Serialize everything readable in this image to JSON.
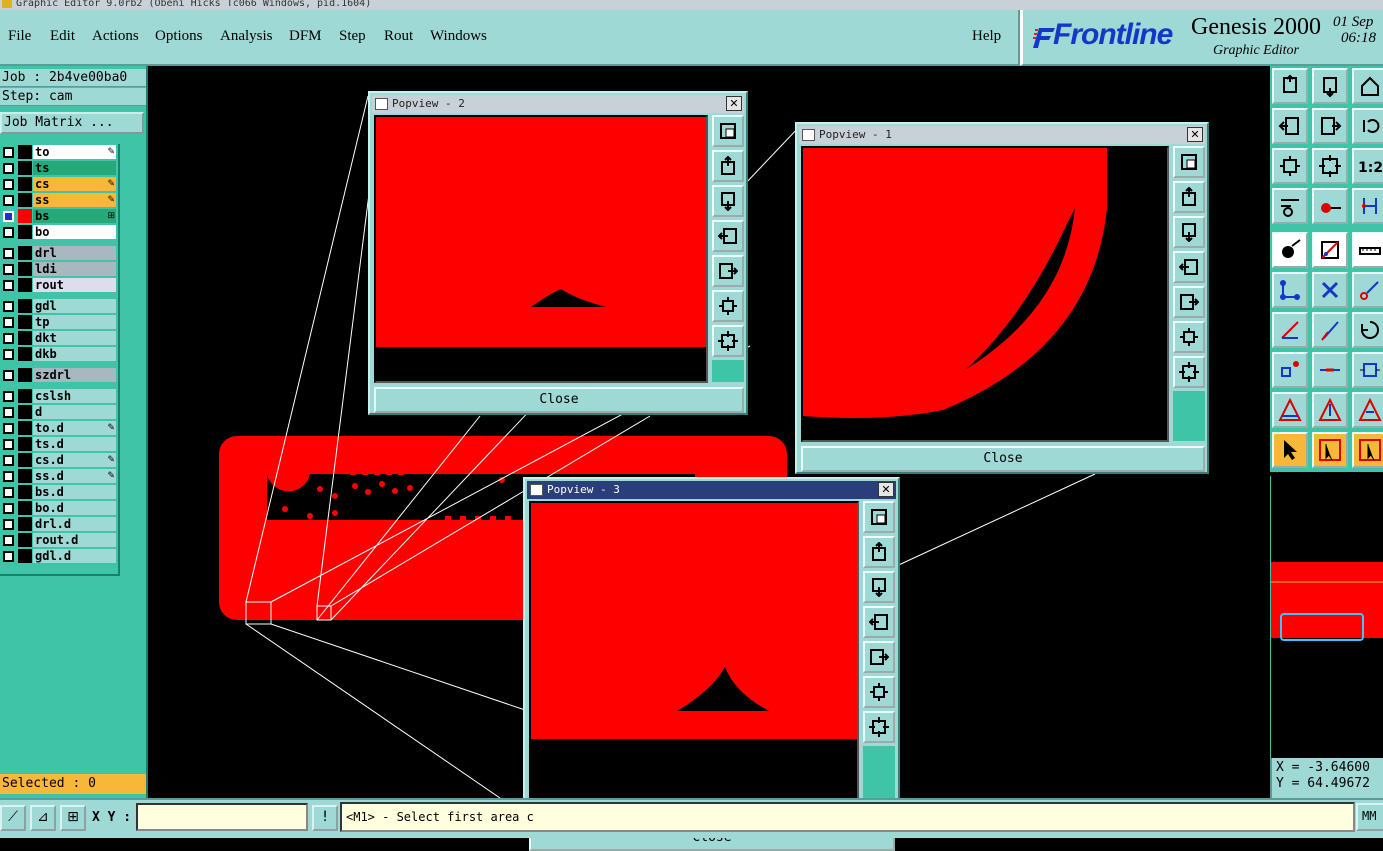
{
  "title_bar": "Graphic Editor 9.0rb2 (Obeni Hicks Tc066 Windows, pid.1604)",
  "menu": [
    {
      "label": "File"
    },
    {
      "label": "Edit"
    },
    {
      "label": "Actions"
    },
    {
      "label": "Options"
    },
    {
      "label": "Analysis"
    },
    {
      "label": "DFM"
    },
    {
      "label": "Step"
    },
    {
      "label": "Rout"
    },
    {
      "label": "Windows"
    },
    {
      "label": "Help"
    }
  ],
  "brand": {
    "logo": "Frontline",
    "product": "Genesis 2000",
    "subtitle": "Graphic Editor",
    "date": "01 Sep",
    "time": "06:18"
  },
  "job": {
    "label": "Job : 2b4ve00ba0",
    "step": "Step: cam",
    "matrix_button": "Job Matrix ..."
  },
  "layers": [
    {
      "name": "to",
      "style": "white",
      "marker": "✎",
      "active": false,
      "red": false
    },
    {
      "name": "ts",
      "style": "green",
      "marker": "",
      "active": false,
      "red": false
    },
    {
      "name": "cs",
      "style": "orange",
      "marker": "✎",
      "active": false,
      "red": false
    },
    {
      "name": "ss",
      "style": "orange",
      "marker": "✎",
      "active": false,
      "red": false
    },
    {
      "name": "bs",
      "style": "green",
      "marker": "⊞",
      "active": true,
      "red": true
    },
    {
      "name": "bo",
      "style": "white",
      "marker": "",
      "active": false,
      "red": false
    },
    {
      "name": "drl",
      "style": "grey",
      "marker": "",
      "active": false,
      "red": false
    },
    {
      "name": "ldi",
      "style": "grey",
      "marker": "",
      "active": false,
      "red": false
    },
    {
      "name": "rout",
      "style": "lgrey",
      "marker": "",
      "active": false,
      "red": false
    },
    {
      "name": "gdl",
      "style": "teal",
      "marker": "",
      "active": false,
      "red": false
    },
    {
      "name": "tp",
      "style": "teal",
      "marker": "",
      "active": false,
      "red": false
    },
    {
      "name": "dkt",
      "style": "teal",
      "marker": "",
      "active": false,
      "red": false
    },
    {
      "name": "dkb",
      "style": "teal",
      "marker": "",
      "active": false,
      "red": false
    },
    {
      "name": "szdrl",
      "style": "grey",
      "marker": "",
      "active": false,
      "red": false
    },
    {
      "name": "cslsh",
      "style": "teal",
      "marker": "",
      "active": false,
      "red": false
    },
    {
      "name": "d",
      "style": "teal",
      "marker": "",
      "active": false,
      "red": false
    },
    {
      "name": "to.d",
      "style": "teal",
      "marker": "✎",
      "active": false,
      "red": false
    },
    {
      "name": "ts.d",
      "style": "teal",
      "marker": "",
      "active": false,
      "red": false
    },
    {
      "name": "cs.d",
      "style": "teal",
      "marker": "✎",
      "active": false,
      "red": false
    },
    {
      "name": "ss.d",
      "style": "teal",
      "marker": "✎",
      "active": false,
      "red": false
    },
    {
      "name": "bs.d",
      "style": "teal",
      "marker": "",
      "active": false,
      "red": false
    },
    {
      "name": "bo.d",
      "style": "teal",
      "marker": "",
      "active": false,
      "red": false
    },
    {
      "name": "drl.d",
      "style": "teal",
      "marker": "",
      "active": false,
      "red": false
    },
    {
      "name": "rout.d",
      "style": "teal",
      "marker": "",
      "active": false,
      "red": false
    },
    {
      "name": "gdl.d",
      "style": "teal",
      "marker": "",
      "active": false,
      "red": false
    }
  ],
  "selected": "Selected : 0",
  "status": {
    "xy_label": "X Y :",
    "xy_value": "",
    "prompt": "<M1> - Select first area c",
    "units": "MM"
  },
  "coords": {
    "x": "X = -3.64600",
    "y": "Y = 64.49672"
  },
  "popviews": {
    "p1": {
      "title": "Popview - 1",
      "close": "Close"
    },
    "p2": {
      "title": "Popview - 2",
      "close": "Close"
    },
    "p3": {
      "title": "Popview - 3",
      "close": "Close"
    }
  },
  "colors": {
    "panel": "#9ed9d6",
    "teal": "#40c4a8",
    "feature": "#ff0000",
    "accent": "#1537c8"
  }
}
